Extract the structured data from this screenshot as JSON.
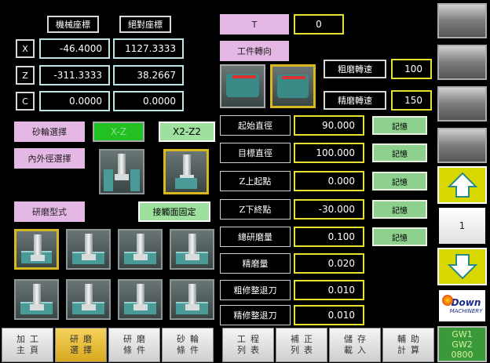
{
  "coords": {
    "machine_label": "機械座標",
    "absolute_label": "絕對座標",
    "rows": [
      {
        "axis": "X",
        "machine": "-46.4000",
        "absolute": "1127.3333"
      },
      {
        "axis": "Z",
        "machine": "-311.3333",
        "absolute": "38.2667"
      },
      {
        "axis": "C",
        "machine": "0.0000",
        "absolute": "0.0000"
      }
    ]
  },
  "t": {
    "label": "T",
    "value": "0"
  },
  "workpiece": {
    "label": "工件轉向"
  },
  "speeds": {
    "rough_label": "粗磨轉速",
    "rough_value": "100",
    "fine_label": "精磨轉速",
    "fine_value": "150"
  },
  "wheel": {
    "label": "砂輪選擇",
    "opt1": "X-Z",
    "opt2": "X2-Z2"
  },
  "diameter": {
    "label": "內外徑選擇"
  },
  "grind_type": {
    "label": "研磨型式",
    "mode": "接觸面固定"
  },
  "params": [
    {
      "label": "起始直徑",
      "value": "90.000",
      "memo": "記憶"
    },
    {
      "label": "目標直徑",
      "value": "100.000",
      "memo": "記憶"
    },
    {
      "label": "Z上起點",
      "value": "0.000",
      "memo": "記憶"
    },
    {
      "label": "Z下終點",
      "value": "-30.000",
      "memo": "記憶"
    },
    {
      "label": "總研磨量",
      "value": "0.100",
      "memo": "記憶"
    },
    {
      "label": "精磨量",
      "value": "0.020",
      "memo": ""
    },
    {
      "label": "粗修整退刀",
      "value": "0.010",
      "memo": ""
    },
    {
      "label": "精修整退刀",
      "value": "0.010",
      "memo": ""
    }
  ],
  "sidebar": {
    "page": "1",
    "logo_main": "Down",
    "logo_sub": "MACHINERY"
  },
  "tabs": [
    {
      "l1": "加工",
      "l2": "主頁"
    },
    {
      "l1": "研磨",
      "l2": "選擇"
    },
    {
      "l1": "研磨",
      "l2": "條件"
    },
    {
      "l1": "砂輪",
      "l2": "條件"
    },
    {
      "l1": "工程",
      "l2": "列表"
    },
    {
      "l1": "補正",
      "l2": "列表"
    },
    {
      "l1": "儲存",
      "l2": "載入"
    },
    {
      "l1": "輔助",
      "l2": "計算"
    }
  ],
  "gw": {
    "l1": "GW1",
    "l2": "GW2",
    "l3": "0800"
  },
  "colors": {
    "accent_yellow": "#e5e032",
    "pink": "#e5b7e5",
    "green": "#9ee09e",
    "active_tab": "#f0c040"
  }
}
